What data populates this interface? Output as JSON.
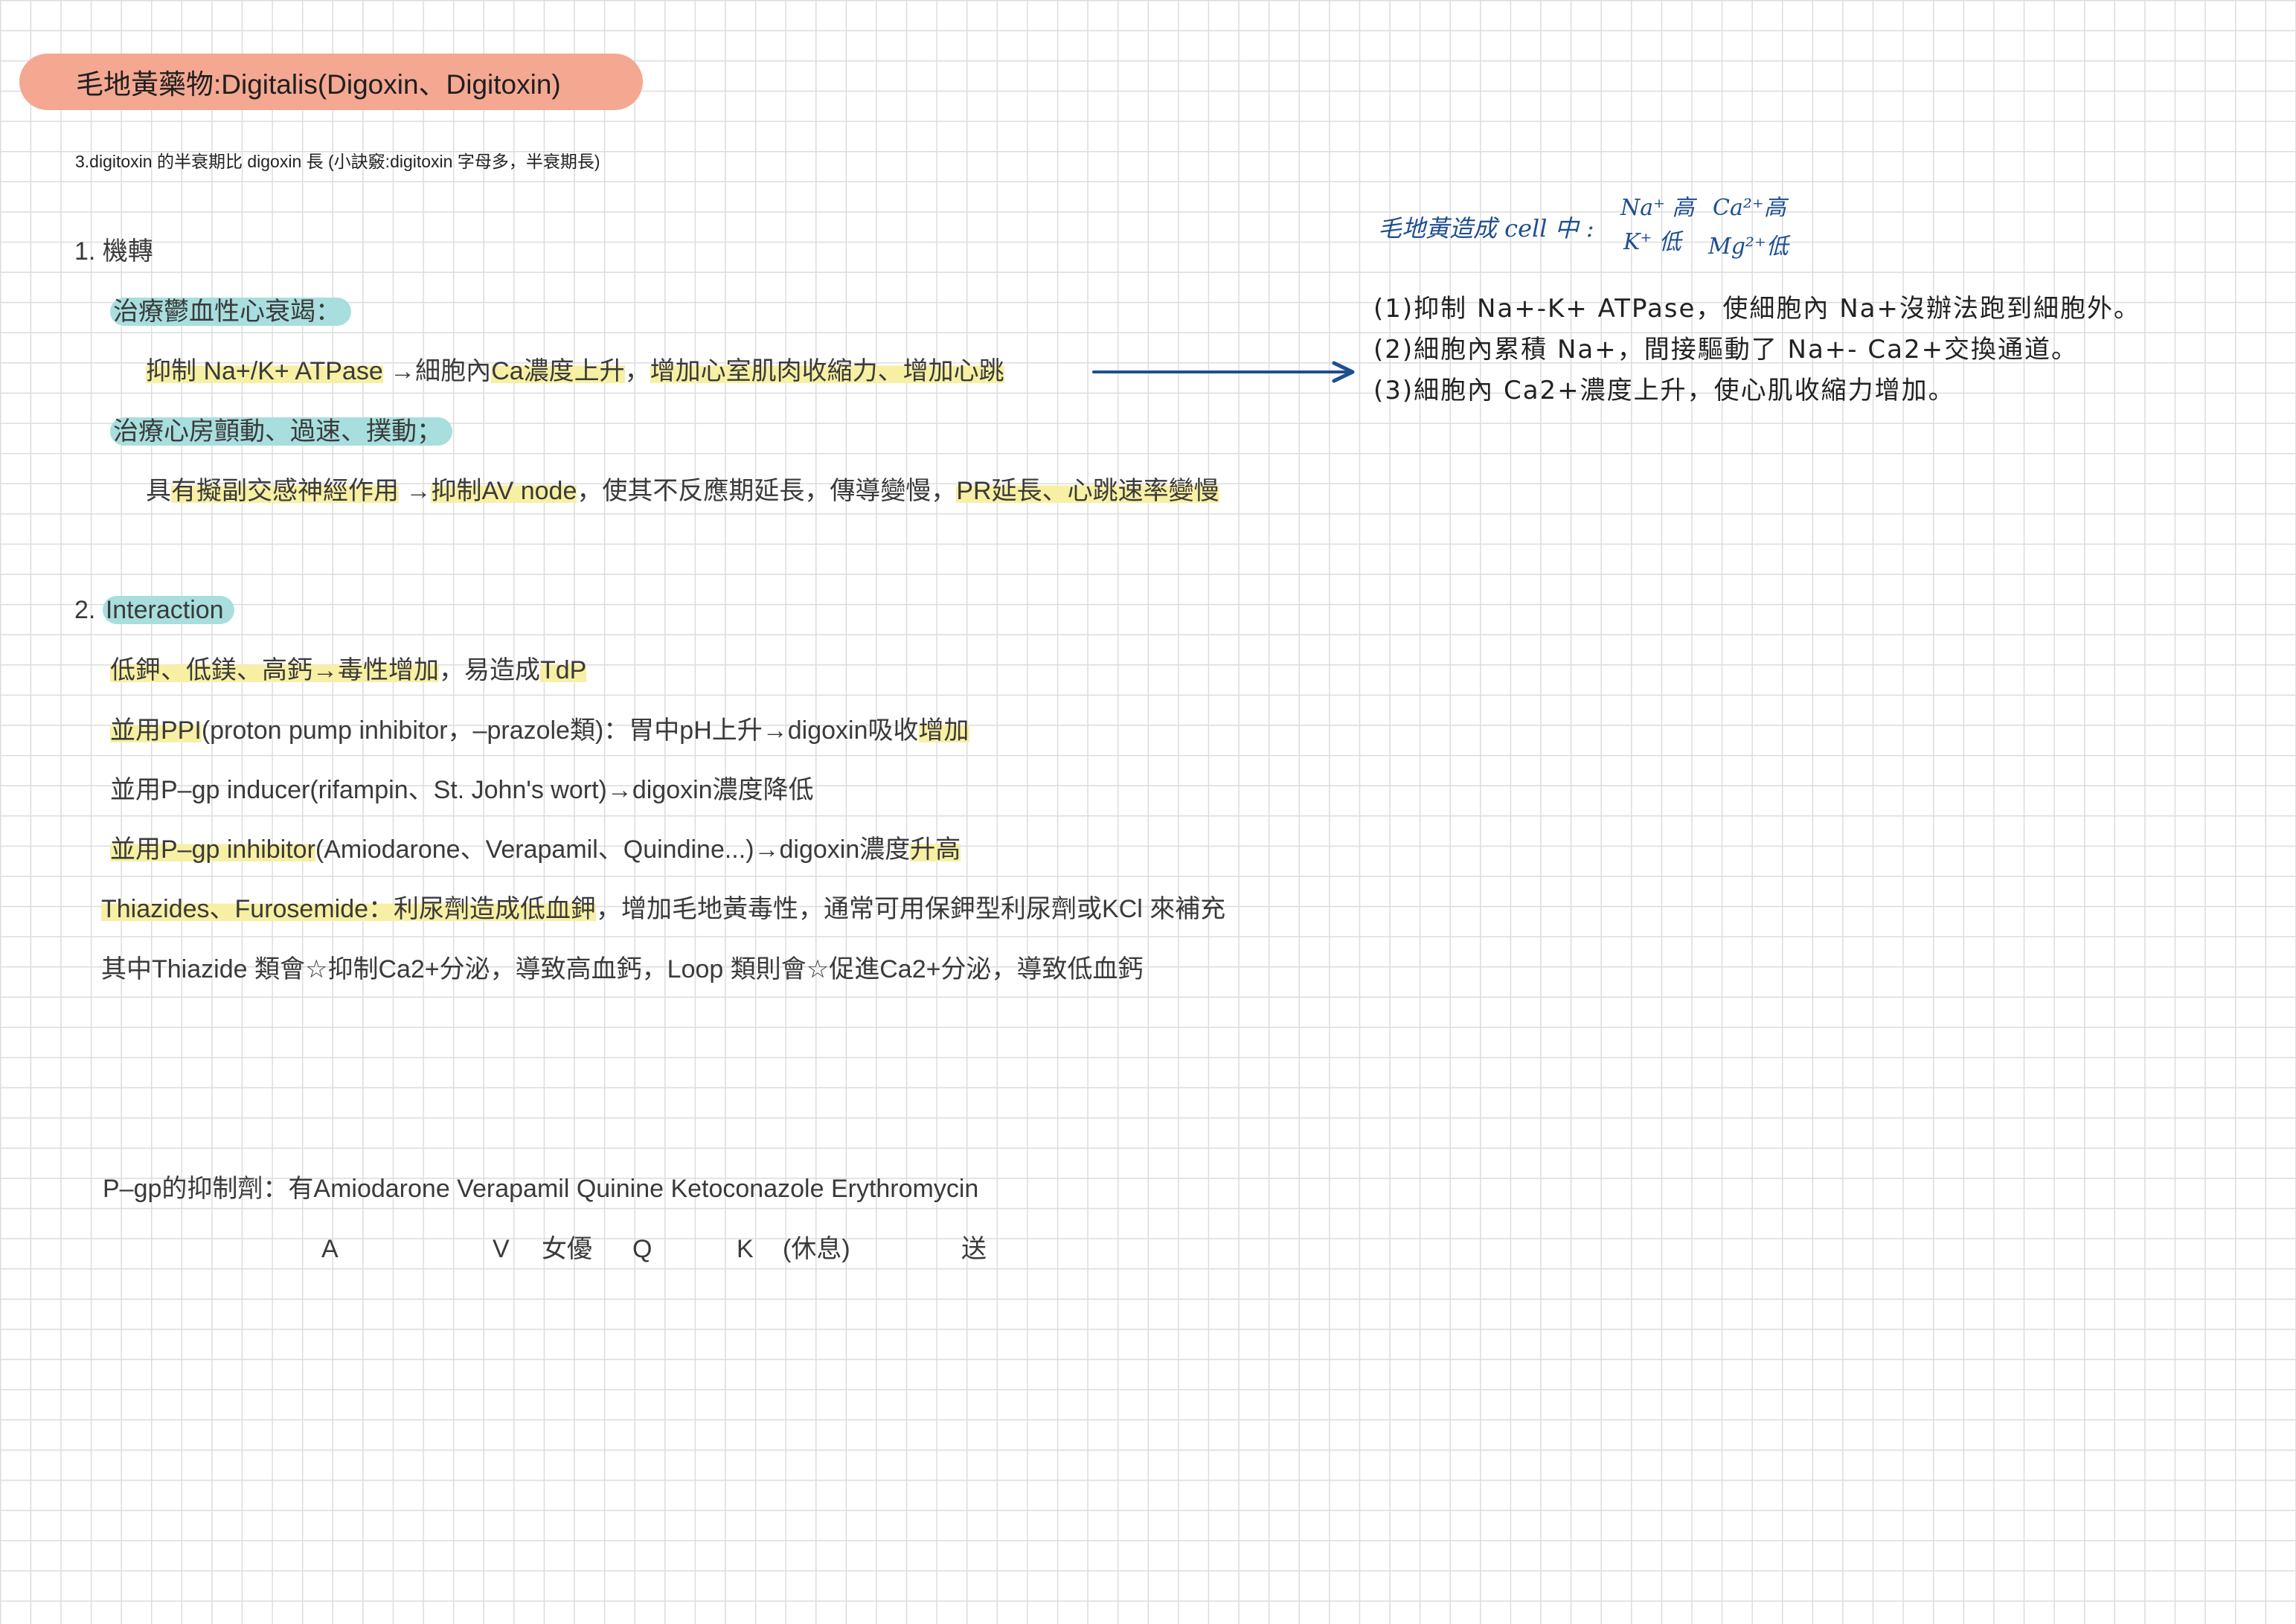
{
  "title": "毛地黃藥物:Digitalis(Digoxin、Digitoxin)",
  "note": "3.digitoxin 的半衰期比 digoxin 長 (小訣竅:digitoxin 字母多，半衰期長)",
  "section1": {
    "heading": "1. 機轉",
    "chf_label": "治療鬱血性心衰竭：",
    "chf_line": {
      "a": "抑制 Na+/K+ ATPase",
      "b": " →細胞內",
      "c": "Ca濃度上升",
      "d": "，",
      "e": "增加心室肌肉收縮力、增加心跳"
    },
    "af_label": "治療心房顫動、過速、撲動；",
    "af_line": {
      "a": "具",
      "b": "有擬副交感神經作用",
      "c": " →",
      "d": "抑制AV node",
      "e": "，使其不反應期延長，傳導變慢，",
      "f": "PR延長、心跳速率變慢"
    }
  },
  "section2": {
    "num": "2. ",
    "heading": "Interaction",
    "lines": {
      "l1a": "低鉀、低鎂、高鈣→毒性增加",
      "l1b": "，易造成",
      "l1c": "TdP",
      "l2a": "並用",
      "l2b": "PPI",
      "l2c": "(proton pump inhibitor，–prazole類)：胃中pH上升→digoxin吸收",
      "l2d": "增加",
      "l3": "並用P–gp inducer(rifampin、St. John's wort)→digoxin濃度降低",
      "l4a": "並用",
      "l4b": "P–gp inhibitor",
      "l4c": "(Amiodarone、Verapamil、Quindine...)→digoxin濃度",
      "l4d": "升高",
      "l5a": "Thiazides、Furosemide：利尿劑造成低血鉀",
      "l5b": "，增加毛地黃毒性，通常可用保鉀型利尿劑或KCl 來補充",
      "l6": "其中Thiazide 類會☆抑制Ca2+分泌，導致高血鈣，Loop 類則會☆促進Ca2+分泌，導致低血鈣"
    }
  },
  "pgp": {
    "line": "P–gp的抑制劑：有Amiodarone Verapamil Quinine Ketoconazole Erythromycin",
    "mnemonic": [
      "A",
      "V",
      "女優",
      "Q",
      "K",
      "(休息)",
      "送"
    ]
  },
  "handwriting": {
    "header": "毛地黃造成 cell 中 :",
    "na_high": "Na⁺ 高",
    "ca_high": "Ca²⁺高",
    "k_low": "K⁺ 低",
    "mg_low": "Mg²⁺低",
    "points": [
      "(1)抑制 Na+-K+ ATPase，使細胞內 Na+沒辦法跑到細胞外。",
      "(2)細胞內累積 Na+，間接驅動了 Na+- Ca2+交換通道。",
      "(3)細胞內 Ca2+濃度上升，使心肌收縮力增加。"
    ]
  },
  "colors": {
    "title_pill": "#f4a892",
    "highlight_yellow": "#f7f0a4",
    "highlight_blue": "#a8dede",
    "arrow": "#1f4f8f",
    "grid": "#dcdcdc"
  }
}
